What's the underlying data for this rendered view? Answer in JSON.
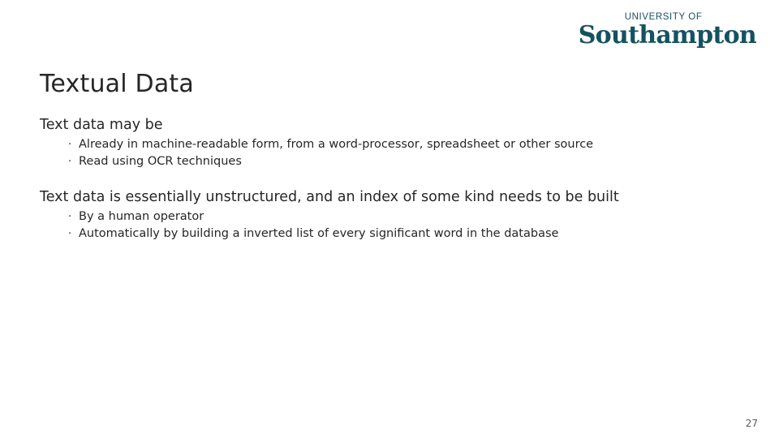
{
  "slide": {
    "title": "Textual Data",
    "page_number": "27",
    "text_color": "#262626"
  },
  "logo": {
    "line_top": "UNIVERSITY OF",
    "line_main": "Southampton",
    "color": "#15525f"
  },
  "content": {
    "blocks": [
      {
        "heading": "Text data may be",
        "bullets": [
          "Already in machine-readable form, from a word-processor, spreadsheet or other source",
          "Read using OCR techniques"
        ]
      },
      {
        "heading": "Text data is essentially unstructured, and an index of some kind needs to be built",
        "bullets": [
          "By a human operator",
          "Automatically by building a inverted list of every significant word in the database"
        ]
      }
    ],
    "bullet_glyph": "·"
  }
}
